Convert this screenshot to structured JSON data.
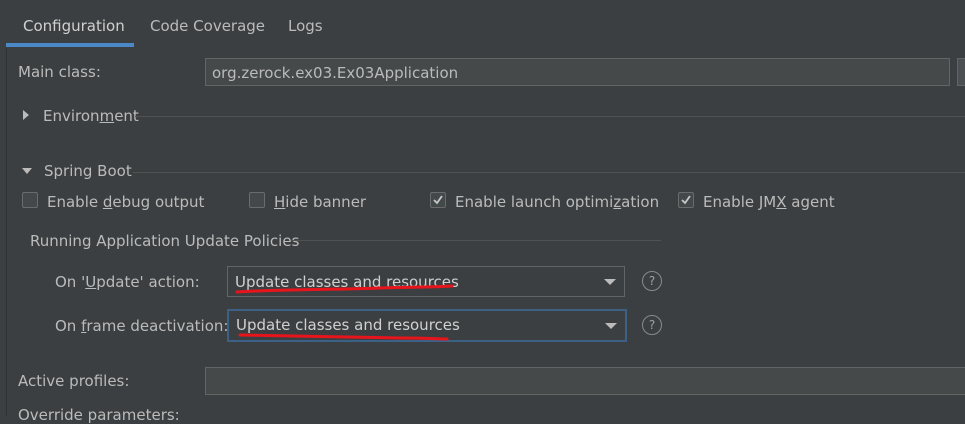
{
  "tabs": [
    {
      "label": "Configuration",
      "active": true
    },
    {
      "label": "Code Coverage",
      "active": false
    },
    {
      "label": "Logs",
      "active": false
    }
  ],
  "main_class": {
    "label": "Main class:",
    "value": "org.zerock.ex03.Ex03Application"
  },
  "environment": {
    "label_pre": "Environ",
    "label_mn": "m",
    "label_post": "ent",
    "expanded": false
  },
  "spring_boot": {
    "label": "Spring Boot",
    "expanded": true,
    "checkboxes": [
      {
        "pre": "Enable ",
        "mn": "d",
        "post": "ebug output",
        "checked": false
      },
      {
        "pre": "",
        "mn": "H",
        "post": "ide banner",
        "checked": false
      },
      {
        "pre": "Enable launch optimi",
        "mn": "z",
        "post": "ation",
        "checked": true
      },
      {
        "pre": "Enable JM",
        "mn": "X",
        "post": " agent",
        "checked": true
      }
    ]
  },
  "update_policies": {
    "title": "Running Application Update Policies",
    "on_update": {
      "pre": "On '",
      "mn": "U",
      "post": "pdate' action:",
      "value": "Update classes and resources"
    },
    "on_frame": {
      "pre": "On ",
      "mn": "f",
      "post": "rame deactivation:",
      "value": "Update classes and resources"
    },
    "help_glyph": "?"
  },
  "active_profiles": {
    "label": "Active profiles:",
    "value": ""
  },
  "override_parameters": {
    "label": "Override parameters:"
  },
  "colors": {
    "accent": "#4a88c7",
    "annotation": "#e8141c",
    "background": "#3c3f41"
  }
}
